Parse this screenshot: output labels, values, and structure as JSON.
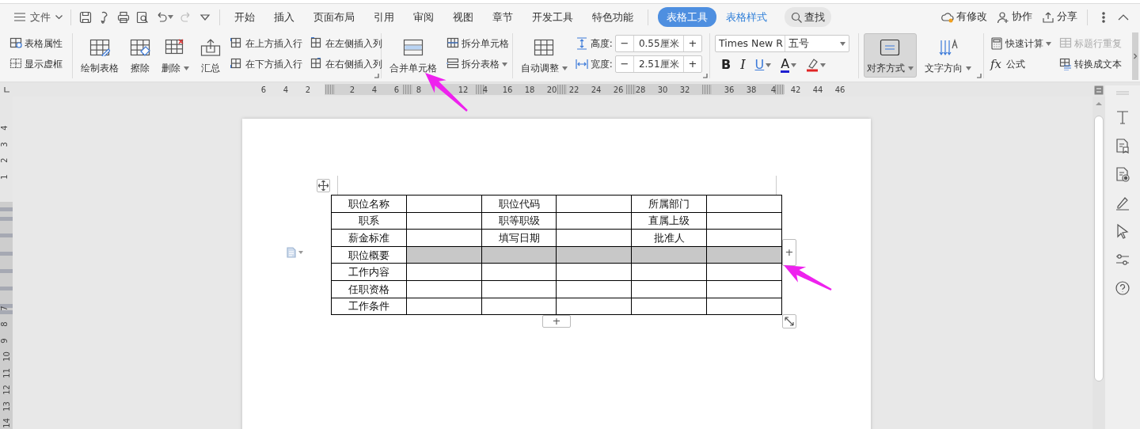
{
  "file_menu": {
    "label": "文件"
  },
  "quick_access": [
    {
      "kind": "save",
      "disabled": false,
      "dropdown": false
    },
    {
      "kind": "painter",
      "disabled": false,
      "dropdown": false
    },
    {
      "kind": "print",
      "disabled": false,
      "dropdown": false
    },
    {
      "kind": "preview",
      "disabled": false,
      "dropdown": false
    },
    {
      "kind": "undo",
      "disabled": false,
      "dropdown": true
    },
    {
      "kind": "redo",
      "disabled": true,
      "dropdown": false
    },
    {
      "kind": "more",
      "disabled": false,
      "dropdown": false
    }
  ],
  "tabs": [
    {
      "label": "开始",
      "selected": false,
      "contextual": false
    },
    {
      "label": "插入",
      "selected": false,
      "contextual": false
    },
    {
      "label": "页面布局",
      "selected": false,
      "contextual": false
    },
    {
      "label": "引用",
      "selected": false,
      "contextual": false
    },
    {
      "label": "审阅",
      "selected": false,
      "contextual": false
    },
    {
      "label": "视图",
      "selected": false,
      "contextual": false
    },
    {
      "label": "章节",
      "selected": false,
      "contextual": false
    },
    {
      "label": "开发工具",
      "selected": false,
      "contextual": false
    },
    {
      "label": "特色功能",
      "selected": false,
      "contextual": false
    },
    {
      "label": "表格工具",
      "selected": true,
      "contextual": true
    },
    {
      "label": "表格样式",
      "selected": false,
      "contextual": true
    }
  ],
  "search": {
    "label": "查找"
  },
  "actions": [
    {
      "kind": "cloud",
      "label": "有修改"
    },
    {
      "kind": "collab",
      "label": "协作"
    },
    {
      "kind": "share",
      "label": "分享"
    }
  ],
  "ribbon": [
    {
      "launcher": false,
      "columns": [
        {
          "kind": "stack",
          "items": [
            {
              "label": "表格属性",
              "dropdown": false,
              "disabled": false
            },
            {
              "label": "显示虚框",
              "dropdown": false,
              "disabled": false
            }
          ]
        }
      ]
    },
    {
      "launcher": true,
      "columns": [
        {
          "kind": "large",
          "label": "绘制表格",
          "dropdown": false,
          "selected": false
        },
        {
          "kind": "large",
          "label": "擦除",
          "dropdown": false,
          "selected": false
        },
        {
          "kind": "large",
          "label": "删除",
          "dropdown": true,
          "selected": false
        },
        {
          "kind": "large",
          "label": "汇总",
          "dropdown": false,
          "selected": false
        },
        {
          "kind": "stack",
          "items": [
            {
              "label": "在上方插入行",
              "dropdown": false,
              "disabled": false
            },
            {
              "label": "在下方插入行",
              "dropdown": false,
              "disabled": false
            }
          ]
        },
        {
          "kind": "stack",
          "items": [
            {
              "label": "在左侧插入列",
              "dropdown": false,
              "disabled": false
            },
            {
              "label": "在右侧插入列",
              "dropdown": false,
              "disabled": false
            }
          ]
        }
      ]
    },
    {
      "launcher": false,
      "columns": [
        {
          "kind": "large",
          "label": "合并单元格",
          "dropdown": false,
          "selected": false
        },
        {
          "kind": "stack",
          "items": [
            {
              "label": "拆分单元格",
              "dropdown": false,
              "disabled": false
            },
            {
              "label": "拆分表格",
              "dropdown": true,
              "disabled": false
            }
          ]
        }
      ]
    },
    {
      "launcher": true,
      "columns": [
        {
          "kind": "large",
          "label": "自动调整",
          "dropdown": true,
          "selected": false
        },
        {
          "kind": "spinners",
          "items": [
            {
              "label": "高度:",
              "value": "0.55厘米",
              "decrement": "−",
              "increment": "+"
            },
            {
              "label": "宽度:",
              "value": "2.51厘米",
              "decrement": "−",
              "increment": "+"
            }
          ]
        }
      ]
    },
    {
      "launcher": false,
      "columns": [
        {
          "kind": "font",
          "font": "Times New R",
          "size": "五号",
          "format": [
            {
              "glyph": "B",
              "dropdown": false
            },
            {
              "glyph": "I",
              "dropdown": false
            },
            {
              "glyph": "U",
              "dropdown": true
            },
            {
              "glyph": "A",
              "dropdown": true,
              "color": "#1f1fd0"
            },
            {
              "dropdown": true,
              "color": "#e02424"
            }
          ]
        }
      ]
    },
    {
      "launcher": true,
      "columns": [
        {
          "kind": "large",
          "label": "对齐方式",
          "dropdown": true,
          "selected": true
        },
        {
          "kind": "large",
          "label": "文字方向",
          "dropdown": true,
          "selected": false
        }
      ]
    },
    {
      "launcher": false,
      "columns": [
        {
          "kind": "stack",
          "items": [
            {
              "label": "快速计算",
              "dropdown": true,
              "disabled": false
            },
            {
              "label": "公式",
              "glyph": "fx",
              "dropdown": false,
              "disabled": false
            }
          ]
        },
        {
          "kind": "stack",
          "items": [
            {
              "label": "标题行重复",
              "dropdown": false,
              "disabled": true
            },
            {
              "label": "转换成文本",
              "dropdown": false,
              "disabled": false
            }
          ]
        }
      ]
    }
  ],
  "horizontal_ruler": [
    "6",
    "4",
    "2",
    "2",
    "4",
    "6",
    "8",
    "12",
    "4",
    "16",
    "18",
    "20",
    "22",
    "24",
    "26",
    "28",
    "30",
    "32",
    "36",
    "38",
    "4",
    "42",
    "44",
    "46"
  ],
  "vertical_ruler": [
    "4",
    "3",
    "2",
    "1",
    "7",
    "8",
    "9",
    "10",
    "11",
    "12",
    "13",
    "14"
  ],
  "table": {
    "rows": [
      {
        "selected": false,
        "labels": [
          "职位名称",
          "职位代码",
          "所属部门"
        ]
      },
      {
        "selected": false,
        "labels": [
          "职系",
          "职等职级",
          "直属上级"
        ]
      },
      {
        "selected": false,
        "labels": [
          "薪金标准",
          "填写日期",
          "批准人"
        ]
      },
      {
        "selected": true,
        "labels": [
          "职位概要"
        ]
      },
      {
        "selected": false,
        "labels": [
          "工作内容"
        ]
      },
      {
        "selected": false,
        "labels": [
          "任职资格"
        ]
      },
      {
        "selected": false,
        "labels": [
          "工作条件"
        ]
      }
    ]
  },
  "add_row": {
    "label": "+"
  },
  "add_column": {
    "label": "+"
  }
}
